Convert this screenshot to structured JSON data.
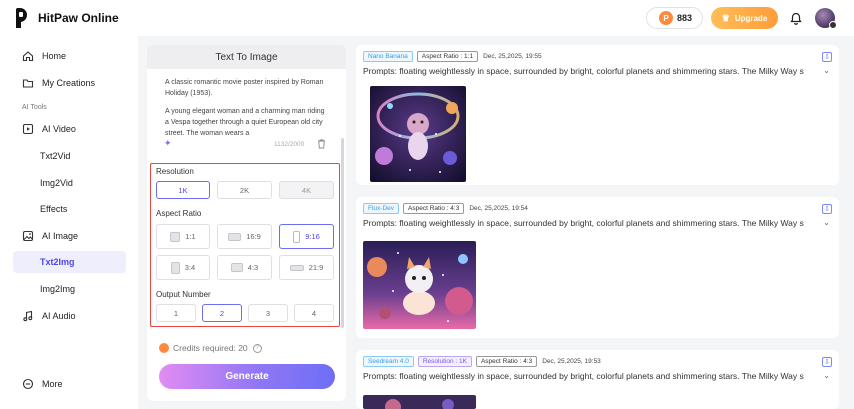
{
  "header": {
    "logo_text": "HitPaw Online",
    "credits": "883",
    "coin_glyph": "P",
    "upgrade_label": "Upgrade"
  },
  "sidebar": {
    "items": [
      {
        "label": "Home",
        "icon": "home-icon"
      },
      {
        "label": "My Creations",
        "icon": "folder-icon"
      },
      {
        "label": "AI Video",
        "icon": "video-icon"
      },
      {
        "label": "Txt2Vid"
      },
      {
        "label": "Img2Vid"
      },
      {
        "label": "Effects"
      },
      {
        "label": "AI Image",
        "icon": "image-icon"
      },
      {
        "label": "Txt2Img",
        "active": true
      },
      {
        "label": "Img2Img"
      },
      {
        "label": "AI Audio",
        "icon": "music-icon"
      },
      {
        "label": "More",
        "icon": "more-icon"
      }
    ],
    "section_label": "AI Tools"
  },
  "panel": {
    "title": "Text To Image",
    "prompt_1": "A classic romantic movie poster inspired by Roman Holiday (1953).",
    "prompt_2": "A young elegant woman and a charming man riding a Vespa together through a quiet European old city street. The woman wears a",
    "char_count": "1132/2000",
    "resolution_label": "Resolution",
    "resolutions": [
      "1K",
      "2K",
      "4K"
    ],
    "aspect_label": "Aspect Ratio",
    "aspects": [
      "1:1",
      "16:9",
      "9:16",
      "3:4",
      "4:3",
      "21:9"
    ],
    "output_label": "Output Number",
    "outputs": [
      "1",
      "2",
      "3",
      "4"
    ],
    "credits_required": "Credits required: 20",
    "generate_label": "Generate"
  },
  "results": [
    {
      "tags": [
        {
          "text": "Nano Banana",
          "style": "blue"
        },
        {
          "text": "Aspect Ratio : 1:1",
          "style": "dark"
        }
      ],
      "date": "Dec, 25,2025, 19:55",
      "prompt": "Prompts: floating weightlessly in space, surrounded by bright, colorful planets and shimmering stars. The Milky Way s"
    },
    {
      "tags": [
        {
          "text": "Flux-Dev",
          "style": "blue"
        },
        {
          "text": "Aspect Ratio : 4:3",
          "style": "dark"
        }
      ],
      "date": "Dec, 25,2025, 19:54",
      "prompt": "Prompts: floating weightlessly in space, surrounded by bright, colorful planets and shimmering stars. The Milky Way s"
    },
    {
      "tags": [
        {
          "text": "Seedream 4.0",
          "style": "blue"
        },
        {
          "text": "Resolution : 1K",
          "style": "purple"
        },
        {
          "text": "Aspect Ratio : 4:3",
          "style": "dark"
        }
      ],
      "date": "Dec, 25,2025, 19:53",
      "prompt": "Prompts: floating weightlessly in space, surrounded by bright, colorful planets and shimmering stars. The Milky Way s"
    }
  ]
}
